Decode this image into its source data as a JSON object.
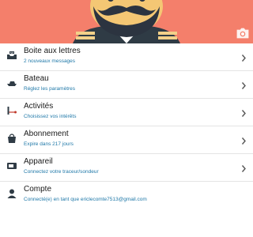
{
  "header": {
    "bg_color": "#f47f6b",
    "camera_icon": "camera-icon"
  },
  "menu": [
    {
      "icon": "inbox-icon",
      "title": "Boite aux lettres",
      "subtitle": "2 nouveaux messages",
      "chevron": true
    },
    {
      "icon": "boat-icon",
      "title": "Bateau",
      "subtitle": "Réglez les paramètres",
      "chevron": true
    },
    {
      "icon": "fishing-icon",
      "title": "Activités",
      "subtitle": "Choisissez vos intérêts",
      "chevron": true
    },
    {
      "icon": "shopping-bag-icon",
      "title": "Abonnement",
      "subtitle": "Expire dans 217 jours",
      "chevron": true
    },
    {
      "icon": "device-icon",
      "title": "Appareil",
      "subtitle": "Connectez votre traceur/sondeur",
      "chevron": true
    },
    {
      "icon": "person-icon",
      "title": "Compte",
      "subtitle": "Connecté(e) en tant que ericlecomte7513@gmail.com",
      "chevron": false
    }
  ],
  "colors": {
    "accent": "#1f78a8",
    "divider": "#e4e4e4"
  }
}
